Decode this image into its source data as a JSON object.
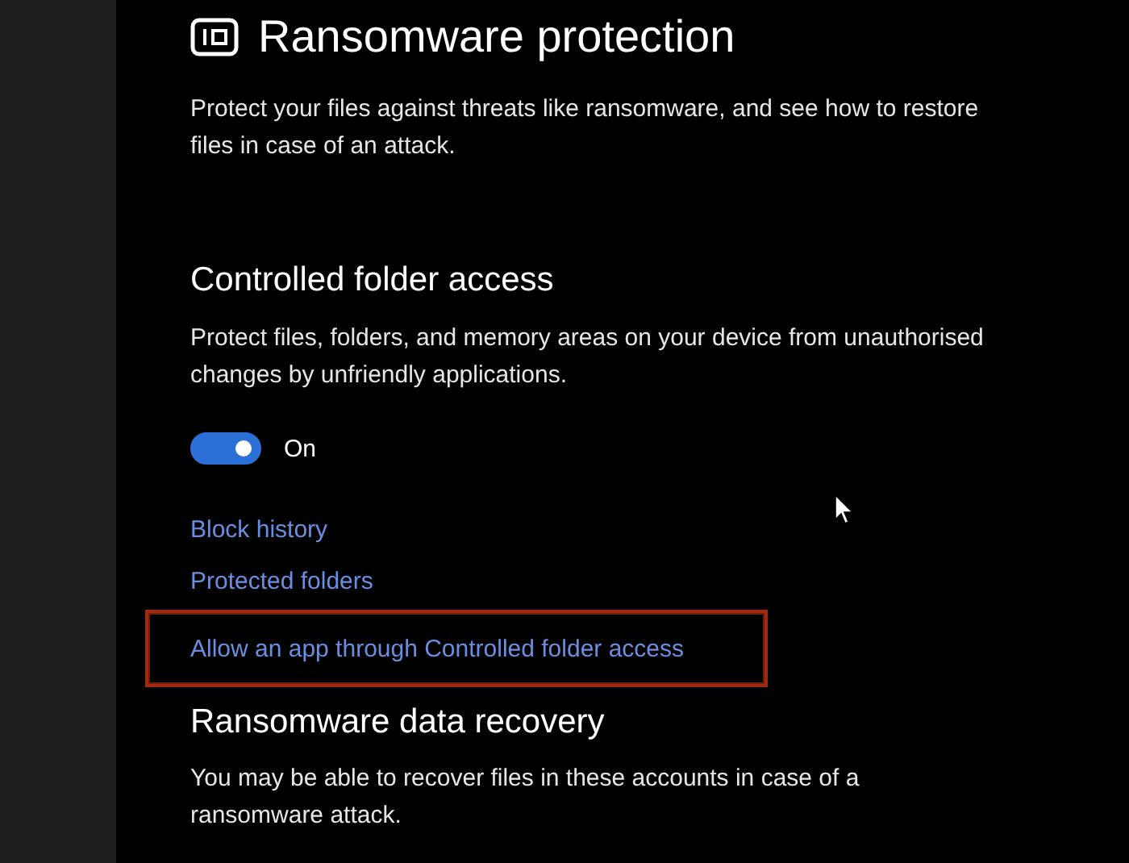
{
  "page": {
    "title": "Ransomware protection",
    "description": "Protect your files against threats like ransomware, and see how to restore files in case of an attack."
  },
  "controlled_folder_access": {
    "heading": "Controlled folder access",
    "description": "Protect files, folders, and memory areas on your device from unauthorised changes by unfriendly applications.",
    "toggle": {
      "on": true,
      "label": "On"
    },
    "links": [
      {
        "label": "Block history",
        "highlighted": false
      },
      {
        "label": "Protected folders",
        "highlighted": false
      },
      {
        "label": "Allow an app through Controlled folder access",
        "highlighted": true
      }
    ]
  },
  "data_recovery": {
    "heading": "Ransomware data recovery",
    "description": "You may be able to recover files in these accounts in case of a ransomware attack."
  }
}
